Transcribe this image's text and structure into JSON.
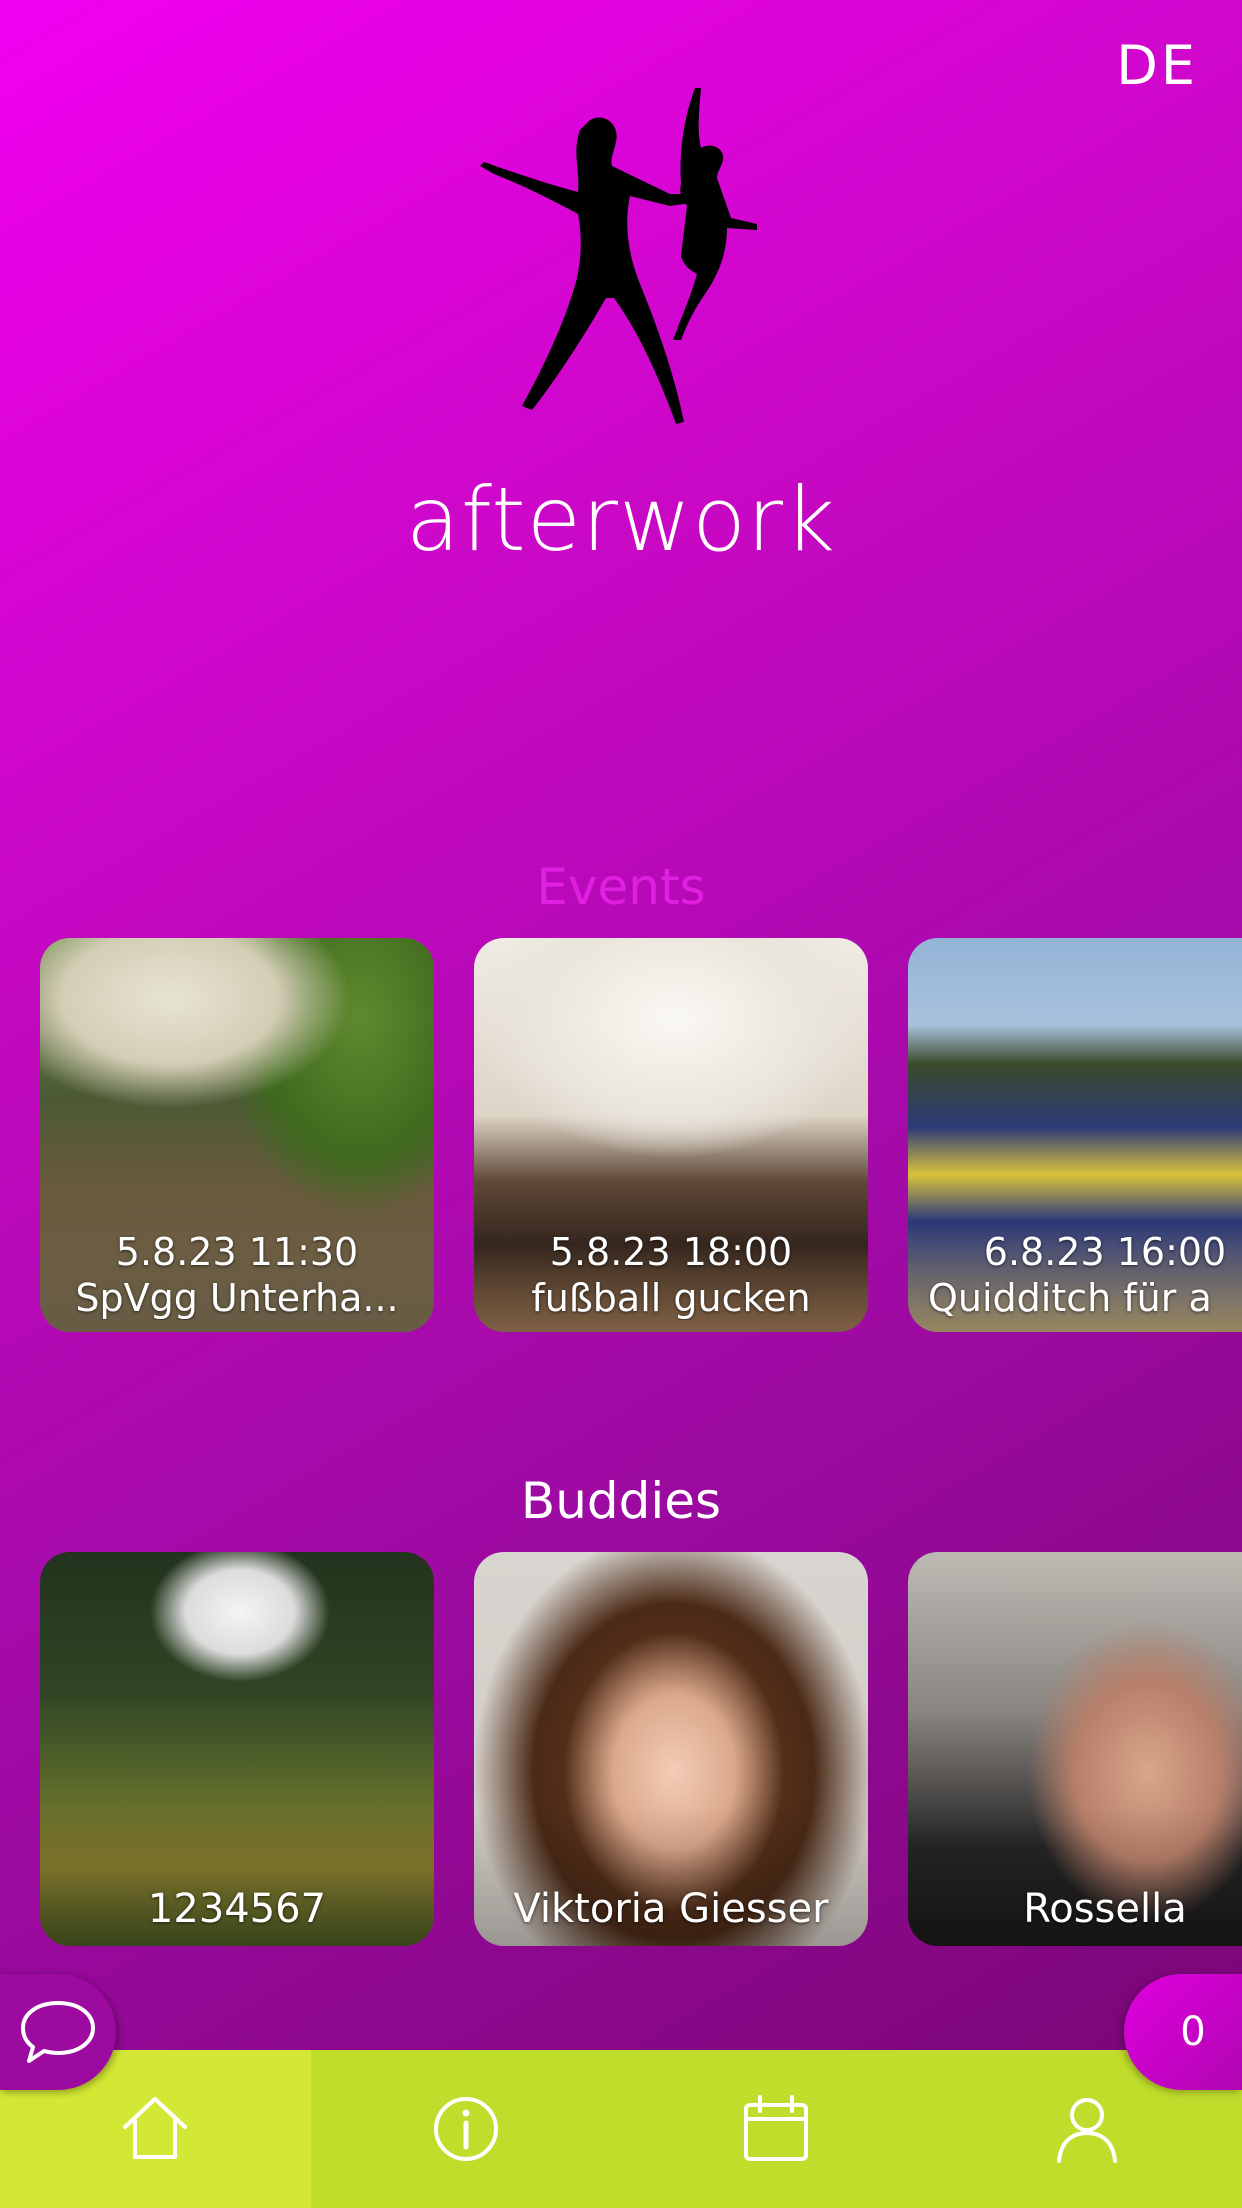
{
  "header": {
    "language": "DE"
  },
  "logo": {
    "text": "afterwork"
  },
  "events": {
    "title": "Events",
    "title_color": "#e020e0",
    "items": [
      {
        "datetime": "5.8.23 11:30",
        "title": "SpVgg Unterha..."
      },
      {
        "datetime": "5.8.23 18:00",
        "title": "fußball gucken"
      },
      {
        "datetime": "6.8.23 16:00",
        "title": "Quidditch für a"
      }
    ]
  },
  "buddies": {
    "title": "Buddies",
    "items": [
      {
        "name": "1234567"
      },
      {
        "name": "Viktoria Giesser"
      },
      {
        "name": "Rossella"
      }
    ]
  },
  "floating": {
    "chat_icon": "chat-bubble-icon",
    "count": "0"
  },
  "tabbar": {
    "color": "#c1dd2b",
    "active_color": "#d3e834",
    "items": [
      {
        "icon": "home-icon",
        "active": true
      },
      {
        "icon": "info-icon"
      },
      {
        "icon": "calendar-icon"
      },
      {
        "icon": "user-icon"
      }
    ]
  }
}
